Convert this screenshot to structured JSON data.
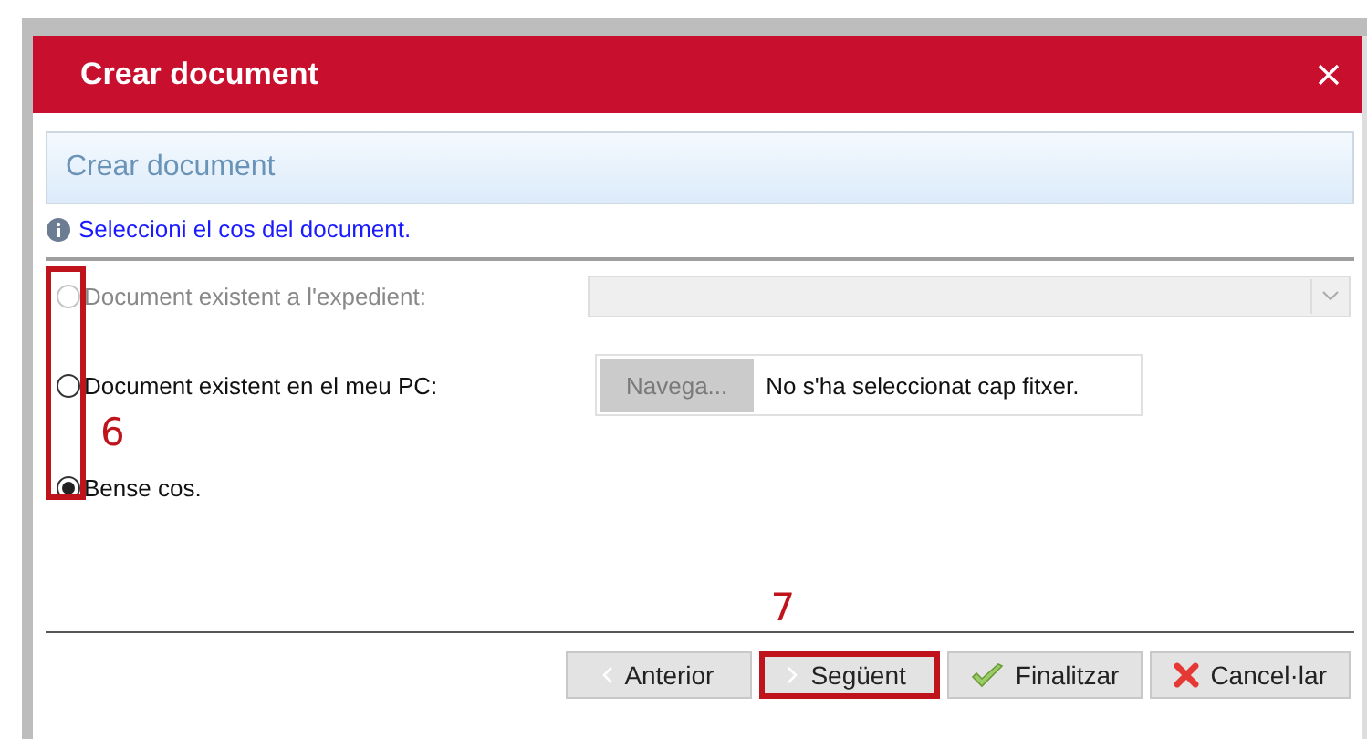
{
  "window": {
    "title": "Crear document"
  },
  "panel": {
    "heading": "Crear document",
    "info": "Seleccioni el cos del document."
  },
  "options": [
    {
      "label": "Document existent a l'expedient:",
      "selected": false,
      "disabled": true,
      "kind": "select"
    },
    {
      "label": "Document existent en el meu PC:",
      "selected": false,
      "disabled": false,
      "kind": "file",
      "button": "Navega...",
      "status": "No s'ha seleccionat cap fitxer."
    },
    {
      "label": "Bense cos.",
      "selected": true,
      "disabled": false,
      "kind": "none"
    }
  ],
  "options_annotation": "6",
  "buttons": [
    {
      "label": "Anterior",
      "kind": "prev"
    },
    {
      "label": "Següent",
      "kind": "next",
      "annotation": "7"
    },
    {
      "label": "Finalitzar",
      "kind": "finish"
    },
    {
      "label": "Cancel·lar",
      "kind": "cancel"
    }
  ]
}
